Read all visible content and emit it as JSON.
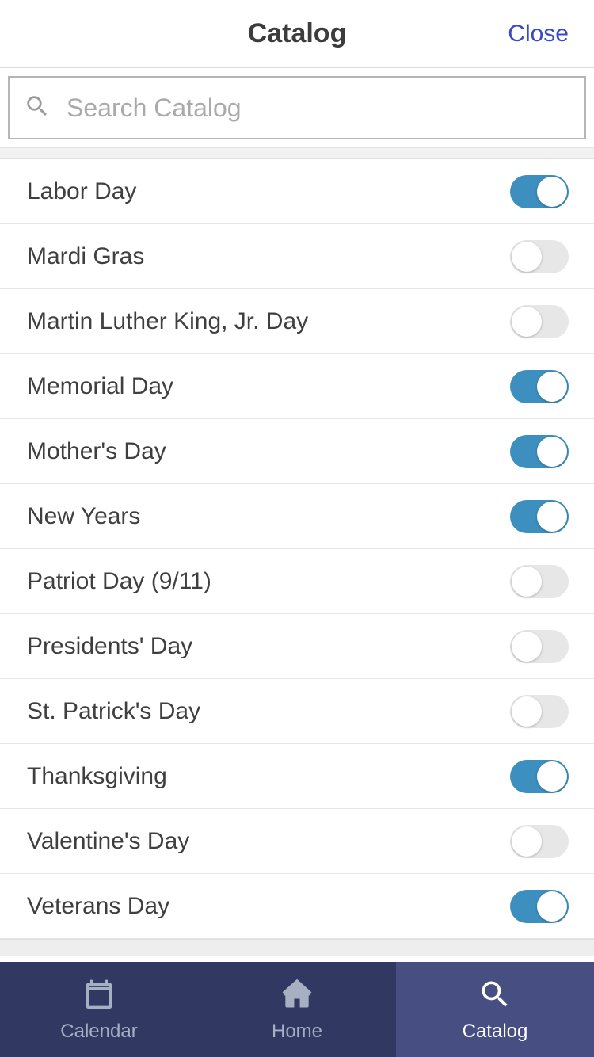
{
  "header": {
    "title": "Catalog",
    "close_label": "Close"
  },
  "search": {
    "placeholder": "Search Catalog",
    "value": ""
  },
  "items": [
    {
      "label": "Labor Day",
      "on": true
    },
    {
      "label": "Mardi Gras",
      "on": false
    },
    {
      "label": "Martin Luther King, Jr. Day",
      "on": false
    },
    {
      "label": "Memorial Day",
      "on": true
    },
    {
      "label": "Mother's Day",
      "on": true
    },
    {
      "label": "New Years",
      "on": true
    },
    {
      "label": "Patriot Day (9/11)",
      "on": false
    },
    {
      "label": "Presidents' Day",
      "on": false
    },
    {
      "label": "St. Patrick's Day",
      "on": false
    },
    {
      "label": "Thanksgiving",
      "on": true
    },
    {
      "label": "Valentine's Day",
      "on": false
    },
    {
      "label": "Veterans Day",
      "on": true
    }
  ],
  "tabs": [
    {
      "label": "Calendar",
      "icon": "calendar-icon",
      "active": false
    },
    {
      "label": "Home",
      "icon": "home-icon",
      "active": false
    },
    {
      "label": "Catalog",
      "icon": "search-icon",
      "active": true
    }
  ]
}
